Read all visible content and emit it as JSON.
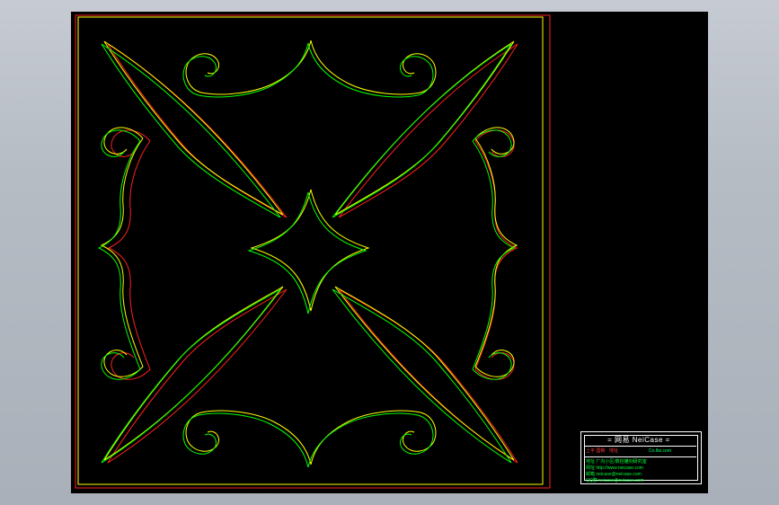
{
  "colors": {
    "workspace_background": "#b6bcc4",
    "canvas": "#000000",
    "layer_yellow": "#ffff00",
    "layer_green": "#00ff00",
    "layer_red": "#ff2020",
    "title_block_border": "#ffffff"
  },
  "drawing": {
    "description_icon": "ornamental-tile-outline-icon"
  },
  "title_block": {
    "header": "= 网易 NeiCase =",
    "sub_left": "上平 国制 · 地址",
    "sub_right": "Co.lbs.com",
    "line1": "地址 厂内小区/数控雕刻研究室",
    "line2": "网址 http://www.neicase.com",
    "line3": "邮箱 neicase@neicase.com",
    "line4": "QQ群 neicase@neicase.com"
  }
}
